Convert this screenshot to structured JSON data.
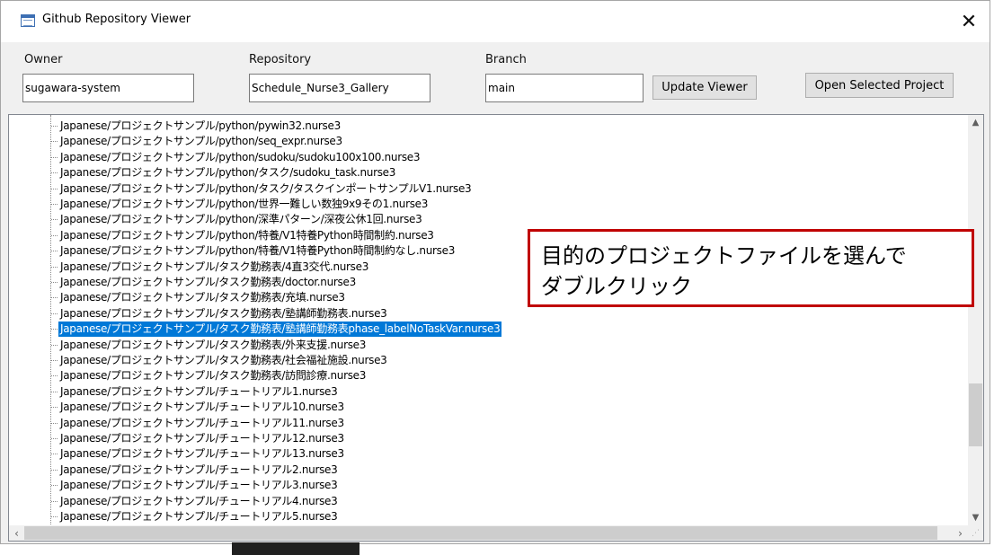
{
  "window": {
    "title": "Github Repository Viewer",
    "close_glyph": "✕"
  },
  "form": {
    "owner_label": "Owner",
    "owner_value": "sugawara-system",
    "repository_label": "Repository",
    "repository_value": "Schedule_Nurse3_Gallery",
    "branch_label": "Branch",
    "branch_value": "main",
    "update_button": "Update Viewer",
    "open_button": "Open Selected Project"
  },
  "tree": {
    "items": [
      "Japanese/プロジェクトサンプル/python/pywin32.nurse3",
      "Japanese/プロジェクトサンプル/python/seq_expr.nurse3",
      "Japanese/プロジェクトサンプル/python/sudoku/sudoku100x100.nurse3",
      "Japanese/プロジェクトサンプル/python/タスク/sudoku_task.nurse3",
      "Japanese/プロジェクトサンプル/python/タスク/タスクインポートサンプルV1.nurse3",
      "Japanese/プロジェクトサンプル/python/世界一難しい数独9x9その1.nurse3",
      "Japanese/プロジェクトサンプル/python/深準パターン/深夜公休1回.nurse3",
      "Japanese/プロジェクトサンプル/python/特養/V1特養Python時間制約.nurse3",
      "Japanese/プロジェクトサンプル/python/特養/V1特養Python時間制約なし.nurse3",
      "Japanese/プロジェクトサンプル/タスク勤務表/4直3交代.nurse3",
      "Japanese/プロジェクトサンプル/タスク勤務表/doctor.nurse3",
      "Japanese/プロジェクトサンプル/タスク勤務表/充填.nurse3",
      "Japanese/プロジェクトサンプル/タスク勤務表/塾講師勤務表.nurse3",
      "Japanese/プロジェクトサンプル/タスク勤務表/塾講師勤務表phase_labelNoTaskVar.nurse3",
      "Japanese/プロジェクトサンプル/タスク勤務表/外来支援.nurse3",
      "Japanese/プロジェクトサンプル/タスク勤務表/社会福祉施設.nurse3",
      "Japanese/プロジェクトサンプル/タスク勤務表/訪問診療.nurse3",
      "Japanese/プロジェクトサンプル/チュートリアル1.nurse3",
      "Japanese/プロジェクトサンプル/チュートリアル10.nurse3",
      "Japanese/プロジェクトサンプル/チュートリアル11.nurse3",
      "Japanese/プロジェクトサンプル/チュートリアル12.nurse3",
      "Japanese/プロジェクトサンプル/チュートリアル13.nurse3",
      "Japanese/プロジェクトサンプル/チュートリアル2.nurse3",
      "Japanese/プロジェクトサンプル/チュートリアル3.nurse3",
      "Japanese/プロジェクトサンプル/チュートリアル4.nurse3",
      "Japanese/プロジェクトサンプル/チュートリアル5.nurse3"
    ],
    "selected_index": 13,
    "selection_color": "#0078d7",
    "vertical_scroll_fraction": 0.8
  },
  "callout": {
    "text": "目的のプロジェクトファイルを選んで\nダブルクリック",
    "border_color": "#c00000"
  },
  "icons": {
    "app": "app-window-icon",
    "close": "close-icon",
    "scroll_up": "chevron-up-icon",
    "scroll_down": "chevron-down-icon",
    "scroll_left": "chevron-left-icon",
    "scroll_right": "chevron-right-icon",
    "size_grip": "size-grip-icon"
  }
}
